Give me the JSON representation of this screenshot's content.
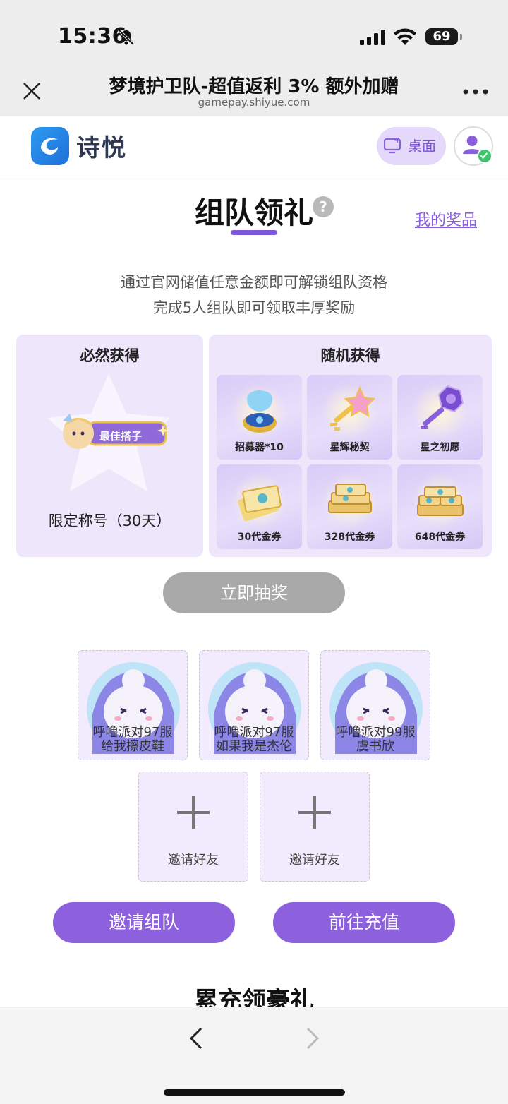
{
  "status_bar": {
    "time": "15:36",
    "battery": "69"
  },
  "browser": {
    "title": "梦境护卫队-超值返利 3% 额外加赠",
    "url": "gamepay.shiyue.com"
  },
  "site_header": {
    "logo_text": "诗悦",
    "desktop_label": "桌面"
  },
  "team_section": {
    "title": "组队领礼",
    "help_glyph": "?",
    "my_prizes_link": "我的奖品",
    "desc_line1": "通过官网储值任意金额即可解锁组队资格",
    "desc_line2": "完成5人组队即可领取丰厚奖励",
    "guaranteed": {
      "heading": "必然获得",
      "badge_text": "最佳搭子",
      "caption": "限定称号（30天）"
    },
    "random": {
      "heading": "随机获得",
      "prizes": [
        {
          "label": "招募器*10",
          "icon": "recruiter-icon"
        },
        {
          "label": "星辉秘契",
          "icon": "star-key-icon"
        },
        {
          "label": "星之初愿",
          "icon": "purple-key-icon"
        },
        {
          "label": "30代金券",
          "icon": "voucher-icon"
        },
        {
          "label": "328代金券",
          "icon": "voucher-stack-icon"
        },
        {
          "label": "648代金券",
          "icon": "voucher-pile-icon"
        }
      ]
    },
    "draw_button": "立即抽奖",
    "members": [
      {
        "line1": "呼噜派对97服",
        "line2": "给我擦皮鞋"
      },
      {
        "line1": "呼噜派对97服",
        "line2": "如果我是杰伦"
      },
      {
        "line1": "呼噜派对99服",
        "line2": "虞书欣"
      }
    ],
    "invite_slots": [
      {
        "label": "邀请好友"
      },
      {
        "label": "邀请好友"
      }
    ],
    "invite_team_button": "邀请组队",
    "recharge_button": "前往充值"
  },
  "next_section_title": "累充领豪礼",
  "colors": {
    "accent": "#8d60dd",
    "panel_bg": "#eee7fc",
    "disabled": "#a9a9a9"
  }
}
